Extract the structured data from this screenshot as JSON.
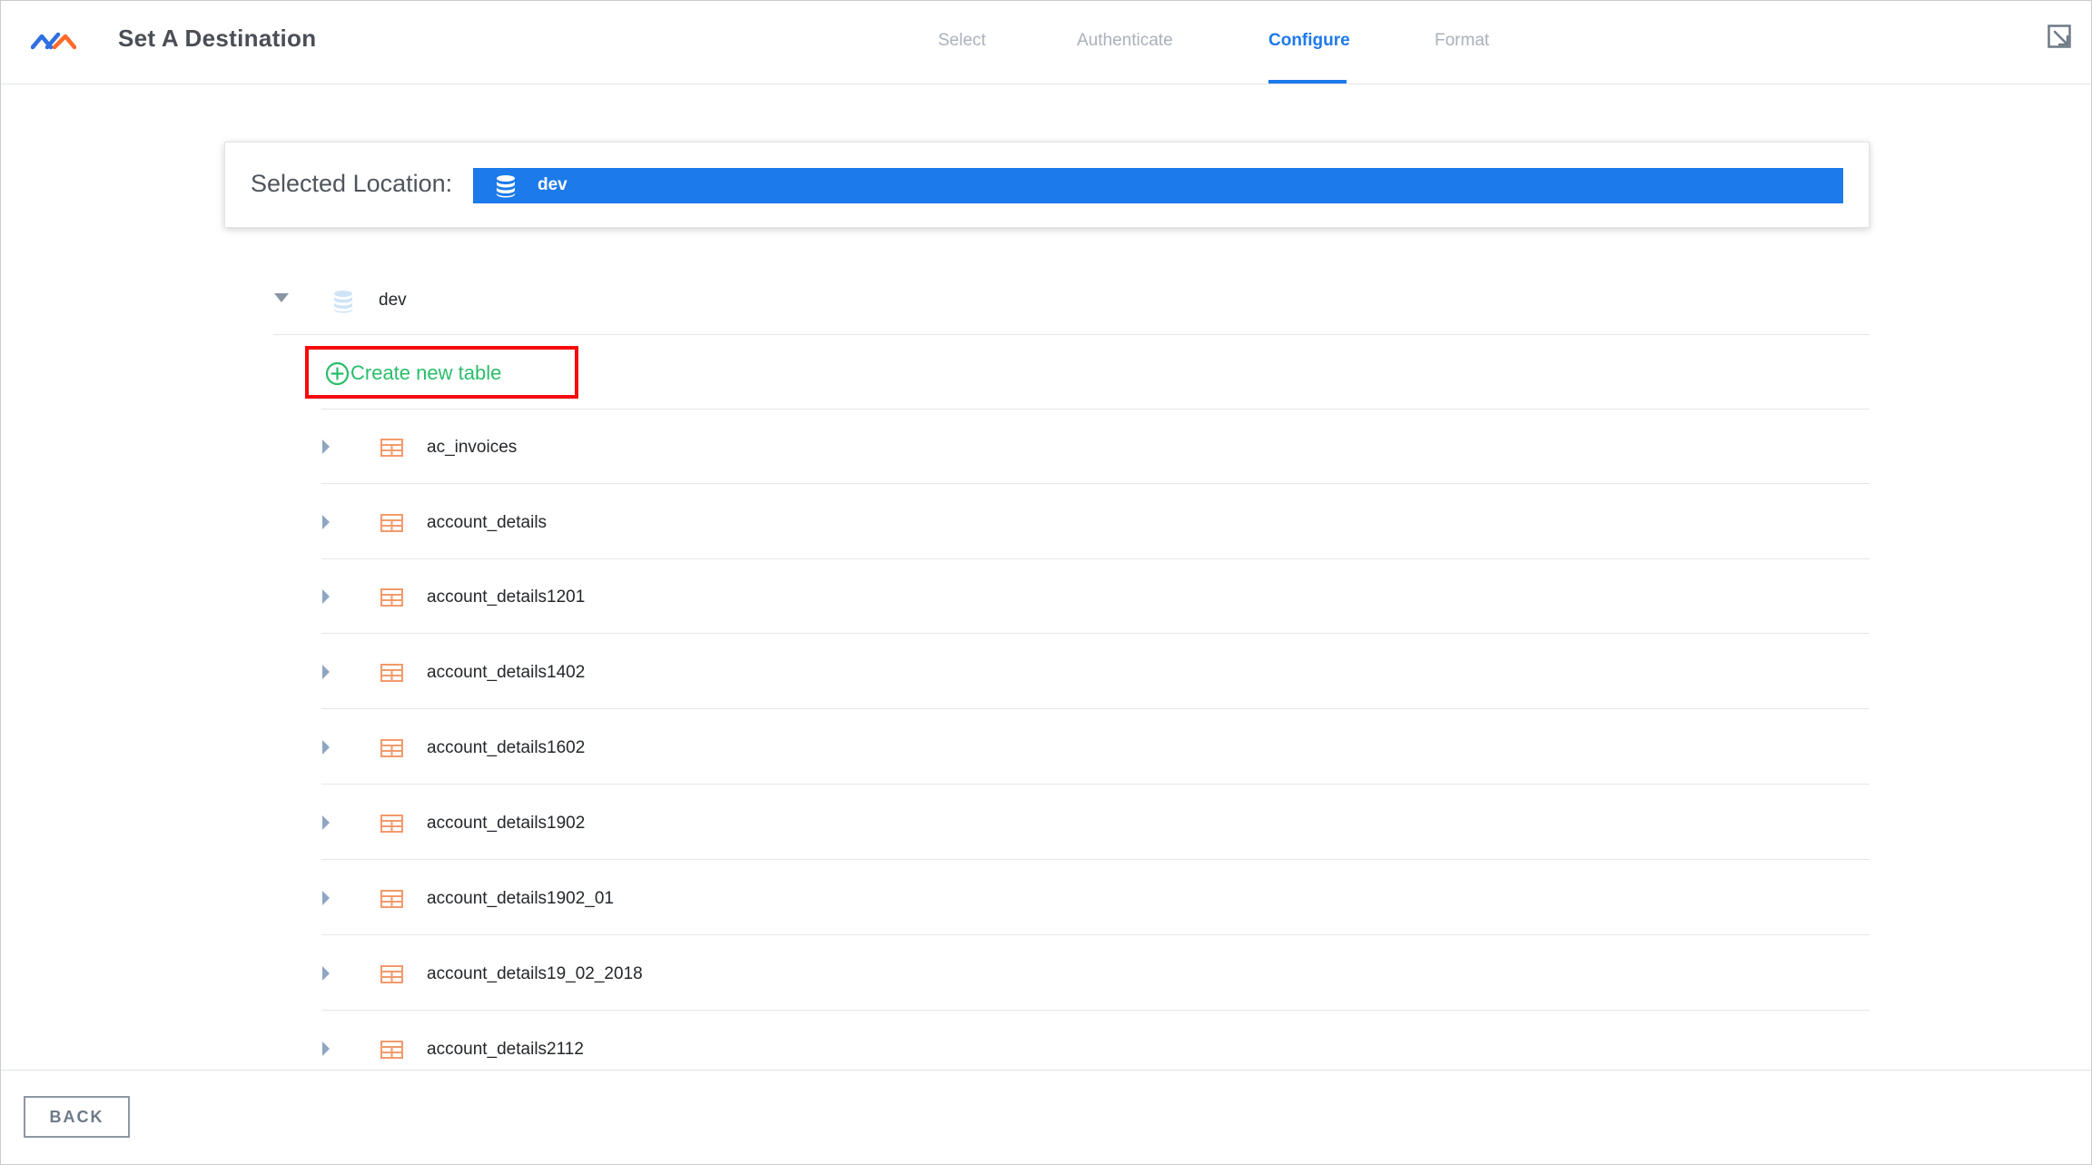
{
  "header": {
    "title": "Set A Destination",
    "steps": [
      {
        "label": "Select",
        "active": false
      },
      {
        "label": "Authenticate",
        "active": false
      },
      {
        "label": "Configure",
        "active": true
      },
      {
        "label": "Format",
        "active": false
      }
    ],
    "expand_icon": "expand-arrow-icon"
  },
  "location": {
    "label": "Selected Location:",
    "value": "dev",
    "icon": "database-icon"
  },
  "tree": {
    "root": {
      "label": "dev",
      "icon": "database-icon",
      "expanded": true
    },
    "create_label": "Create new table",
    "tables": [
      {
        "name": "ac_invoices"
      },
      {
        "name": "account_details"
      },
      {
        "name": "account_details1201"
      },
      {
        "name": "account_details1402"
      },
      {
        "name": "account_details1602"
      },
      {
        "name": "account_details1902"
      },
      {
        "name": "account_details1902_01"
      },
      {
        "name": "account_details19_02_2018"
      },
      {
        "name": "account_details2112"
      }
    ]
  },
  "footer": {
    "back_label": "BACK"
  },
  "colors": {
    "accent": "#1f7aea",
    "create": "#29be6a",
    "highlight": "#f50b0b",
    "table_icon": "#f39a6b"
  }
}
